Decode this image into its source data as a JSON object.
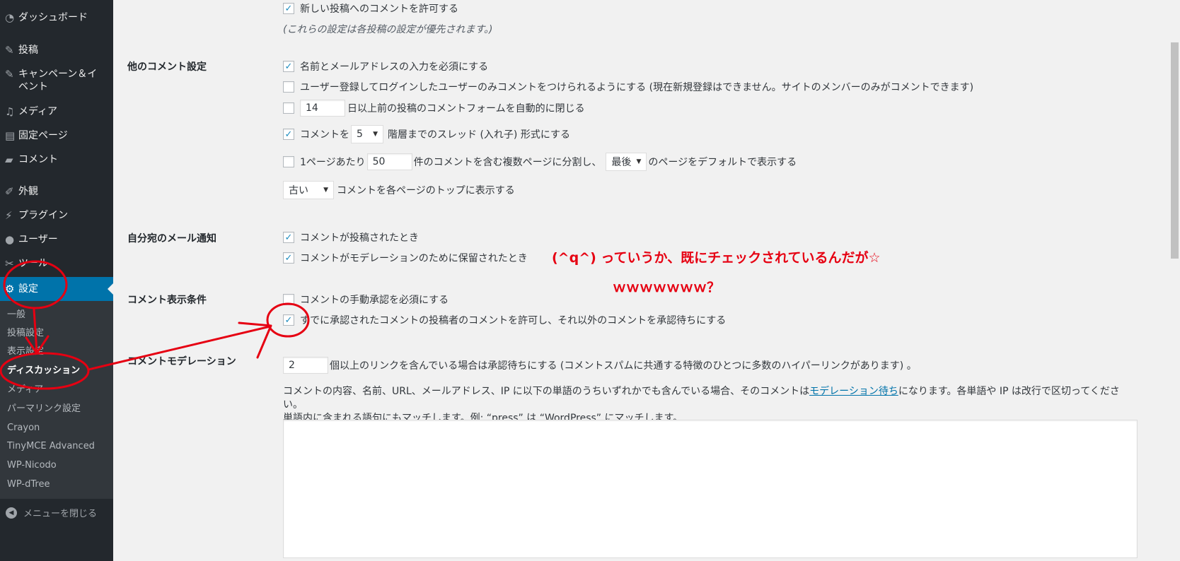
{
  "sidebar": {
    "menu": [
      {
        "label": "ダッシュボード",
        "icon": "dashboard-icon",
        "glyph": "◔"
      },
      {
        "label": "投稿",
        "icon": "pin-icon",
        "glyph": "✎"
      },
      {
        "label": "キャンペーン＆イベント",
        "icon": "pin-icon",
        "glyph": "✎"
      },
      {
        "label": "メディア",
        "icon": "media-icon",
        "glyph": "♫"
      },
      {
        "label": "固定ページ",
        "icon": "page-icon",
        "glyph": "▤"
      },
      {
        "label": "コメント",
        "icon": "comment-icon",
        "glyph": "▰"
      },
      {
        "label": "外観",
        "icon": "appearance-icon",
        "glyph": "✐"
      },
      {
        "label": "プラグイン",
        "icon": "plugin-icon",
        "glyph": "⚡"
      },
      {
        "label": "ユーザー",
        "icon": "user-icon",
        "glyph": "●"
      },
      {
        "label": "ツール",
        "icon": "tools-icon",
        "glyph": "✂"
      },
      {
        "label": "設定",
        "icon": "settings-icon",
        "glyph": "⚙"
      }
    ],
    "submenu": [
      "一般",
      "投稿設定",
      "表示設定",
      "ディスカッション",
      "メディア",
      "パーマリンク設定",
      "Crayon",
      "TinyMCE Advanced",
      "WP-Nicodo",
      "WP-dTree"
    ],
    "collapse_label": "メニューを閉じる"
  },
  "main": {
    "top_row": {
      "label": "新しい投稿へのコメントを許可する",
      "checked": true
    },
    "top_note": "(これらの設定は各投稿の設定が優先されます。)",
    "other": {
      "heading": "他のコメント設定",
      "require_name": "名前とメールアドレスの入力を必須にする",
      "registered_only": "ユーザー登録してログインしたユーザーのみコメントをつけられるようにする (現在新規登録はできません。サイトのメンバーのみがコメントできます)",
      "close_days_value": "14",
      "close_days_label": "日以上前の投稿のコメントフォームを自動的に閉じる",
      "thread_prefix": "コメントを",
      "thread_value": "5",
      "thread_suffix": "階層までのスレッド (入れ子) 形式にする",
      "paginate_prefix": "1ページあたり",
      "paginate_value": "50",
      "paginate_mid": "件のコメントを含む複数ページに分割し、",
      "paginate_select": "最後",
      "paginate_suffix": "のページをデフォルトで表示する",
      "order_select": "古い",
      "order_suffix": "コメントを各ページのトップに表示する"
    },
    "email": {
      "heading": "自分宛のメール通知",
      "on_post": "コメントが投稿されたとき",
      "on_moderation": "コメントがモデレーションのために保留されたとき"
    },
    "display": {
      "heading": "コメント表示条件",
      "manual": "コメントの手動承認を必須にする",
      "previously_approved": "すでに承認されたコメントの投稿者のコメントを許可し、それ以外のコメントを承認待ちにする"
    },
    "moderation": {
      "heading": "コメントモデレーション",
      "links_value": "2",
      "links_label": "個以上のリンクを含んでいる場合は承認待ちにする (コメントスパムに共通する特徴のひとつに多数のハイパーリンクがあります) 。",
      "desc_before": "コメントの内容、名前、URL、メールアドレス、IP に以下の単語のうちいずれかでも含んでいる場合、そのコメントは",
      "desc_link": "モデレーション待ち",
      "desc_after": "になります。各単語や IP は改行で区切ってください。",
      "desc_line2": "単語内に含まれる語句にもマッチします。例: “press” は “WordPress” にマッチします。"
    }
  },
  "annotations": {
    "line1": "(^q^) っていうか、既にチェックされているんだが☆",
    "line2": "ｗｗｗｗｗｗｗ？",
    "color": "#e60012"
  },
  "colors": {
    "sidebar_bg": "#23282d",
    "active": "#0073aa",
    "submenu_bg": "#32373c",
    "link": "#0073aa"
  }
}
